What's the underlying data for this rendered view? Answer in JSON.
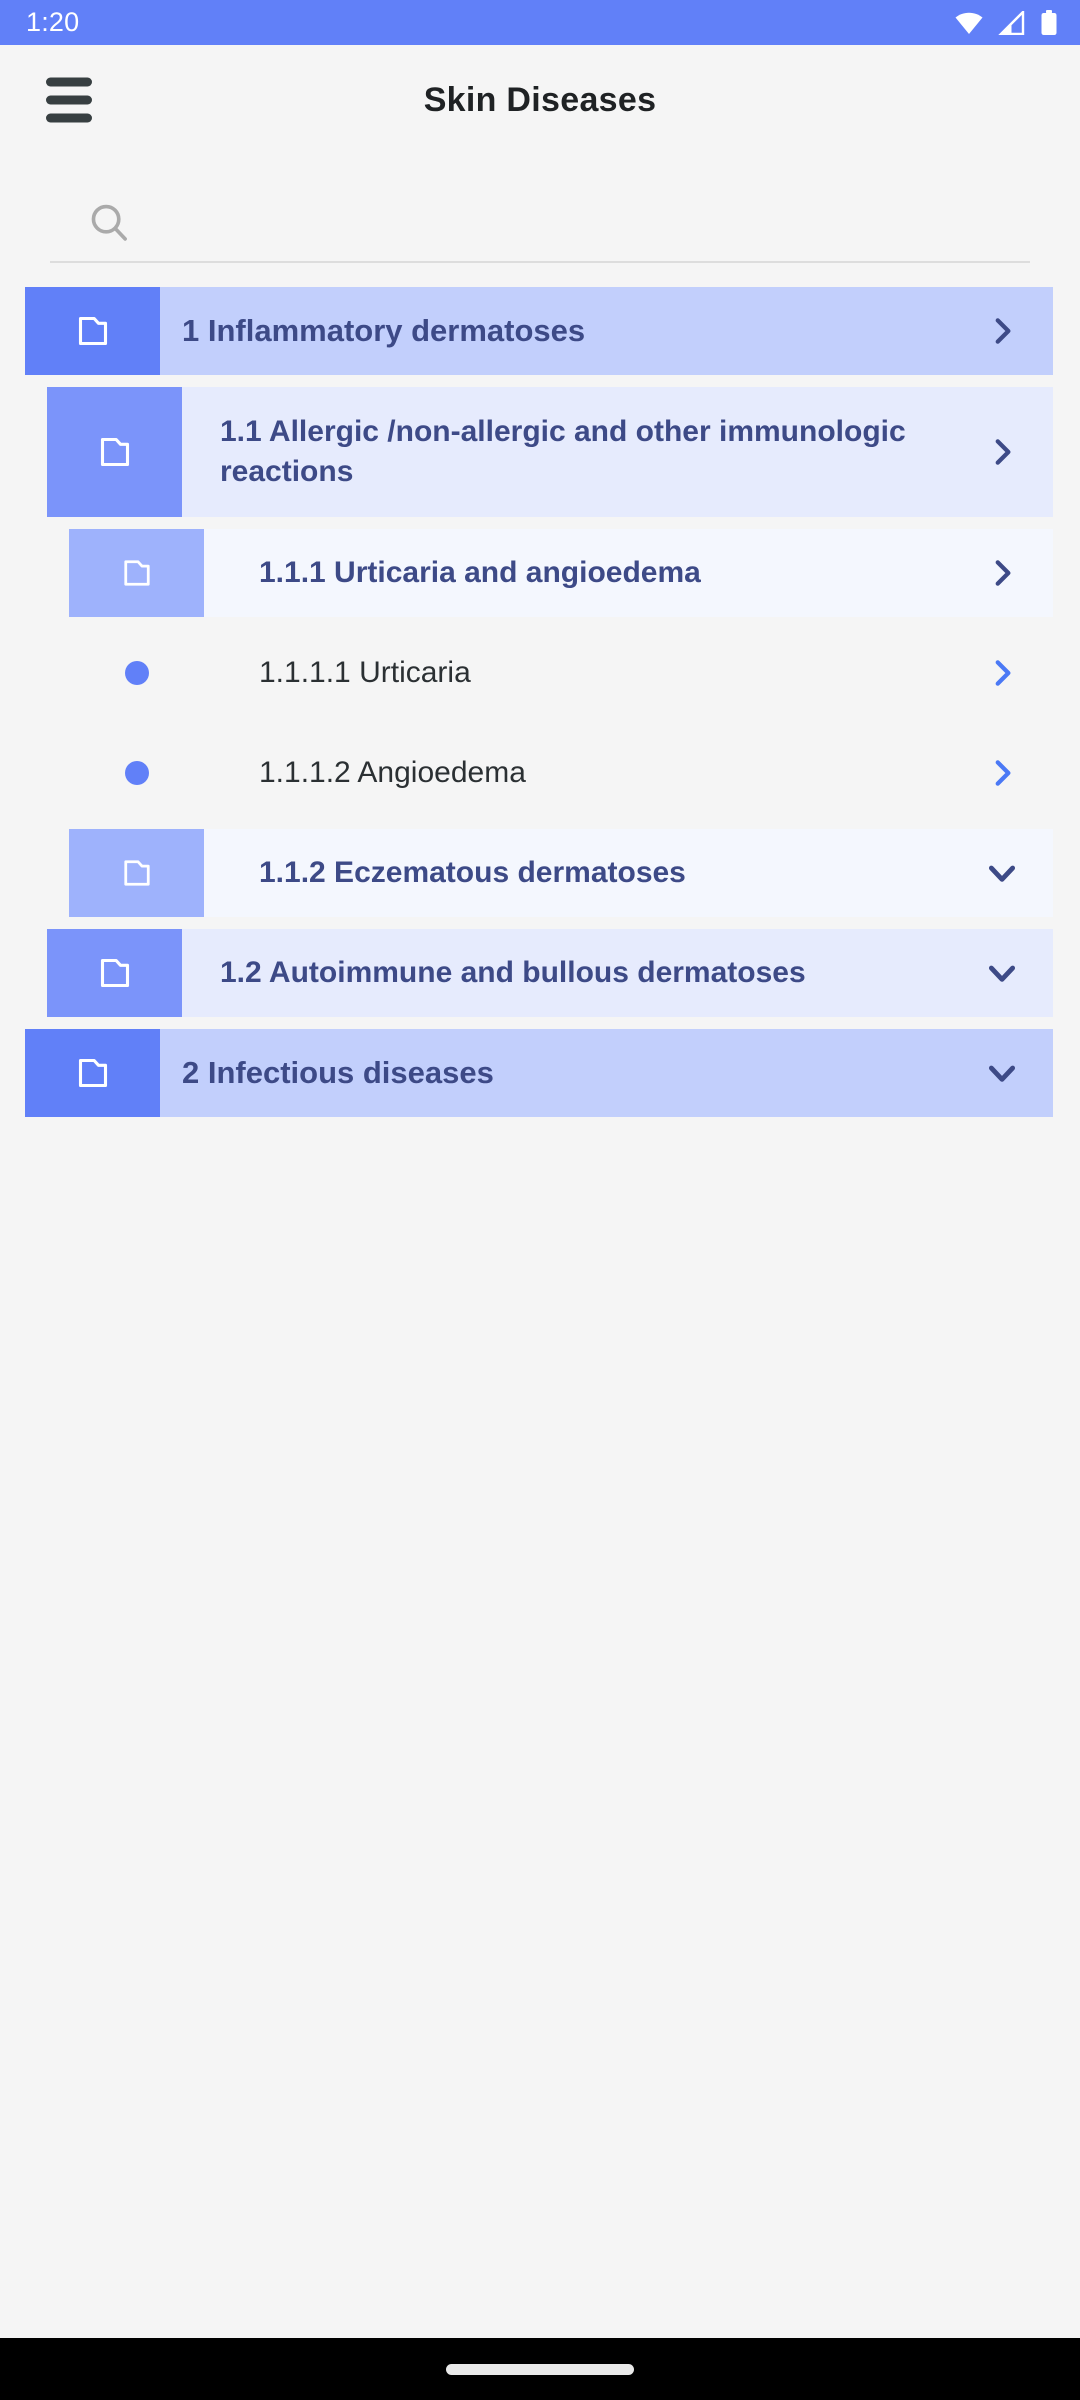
{
  "status_bar": {
    "time": "1:20",
    "icons": [
      "wifi-icon",
      "cell-signal-icon",
      "battery-icon"
    ],
    "background": "#6180f8"
  },
  "app_bar": {
    "menu_icon": "hamburger-menu-icon",
    "title": "Skin Diseases"
  },
  "search": {
    "icon": "search-icon",
    "value": "",
    "placeholder": ""
  },
  "theme": {
    "accent": "#6180f8",
    "level1_icon_bg": "#6180f8",
    "level1_body_bg": "#c2cffc",
    "level2_icon_bg": "#7b94fa",
    "level2_body_bg": "#e6ebfd",
    "level3_icon_bg": "#9eb2fc",
    "level3_body_bg": "#f4f7fe",
    "label_color": "#3d4a87",
    "leaf_label_color": "#2b3033",
    "page_bg": "#f5f5f5"
  },
  "tree": {
    "items": [
      {
        "label": "1 Inflammatory dermatoses",
        "level": 1,
        "icon": "folder-icon",
        "expanded": true,
        "chevron": "chevron-right-icon"
      },
      {
        "label": "1.1 Allergic /non-allergic  and other immunologic  reactions",
        "level": 2,
        "icon": "folder-icon",
        "expanded": true,
        "chevron": "chevron-right-icon"
      },
      {
        "label": "1.1.1 Urticaria and angioedema",
        "level": 3,
        "icon": "folder-icon",
        "expanded": true,
        "chevron": "chevron-right-icon"
      },
      {
        "label": "1.1.1.1 Urticaria",
        "level": 4,
        "icon": "bullet-dot-icon",
        "expanded": false,
        "chevron": "chevron-right-icon"
      },
      {
        "label": "1.1.1.2 Angioedema",
        "level": 4,
        "icon": "bullet-dot-icon",
        "expanded": false,
        "chevron": "chevron-right-icon"
      },
      {
        "label": "1.1.2 Eczematous dermatoses",
        "level": 3,
        "icon": "folder-icon",
        "expanded": false,
        "chevron": "chevron-down-icon"
      },
      {
        "label": "1.2 Autoimmune and bullous dermatoses",
        "level": 2,
        "icon": "folder-icon",
        "expanded": false,
        "chevron": "chevron-down-icon"
      },
      {
        "label": "2 Infectious diseases",
        "level": 1,
        "icon": "folder-icon",
        "expanded": false,
        "chevron": "chevron-down-icon"
      }
    ]
  },
  "nav_bar": {
    "handle": "gesture-home-handle"
  }
}
